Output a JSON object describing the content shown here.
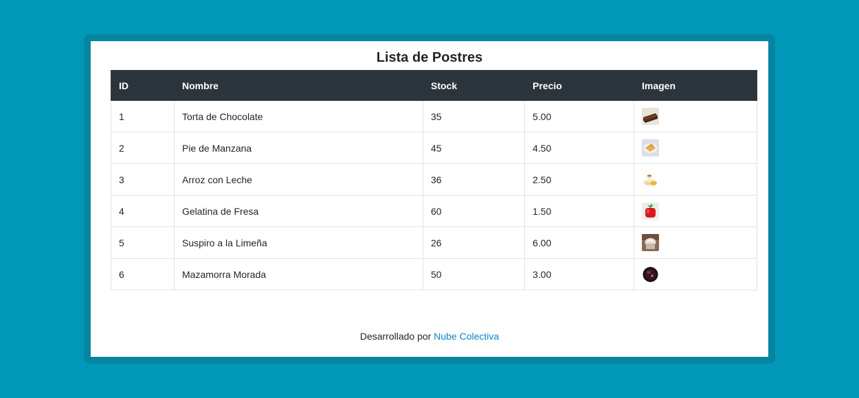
{
  "page": {
    "title": "Lista de Postres"
  },
  "table": {
    "headers": [
      "ID",
      "Nombre",
      "Stock",
      "Precio",
      "Imagen"
    ],
    "rows": [
      {
        "id": "1",
        "nombre": "Torta de Chocolate",
        "stock": "35",
        "precio": "5.00",
        "imagen_icon": "chocolate-cake-icon"
      },
      {
        "id": "2",
        "nombre": "Pie de Manzana",
        "stock": "45",
        "precio": "4.50",
        "imagen_icon": "apple-pie-icon"
      },
      {
        "id": "3",
        "nombre": "Arroz con Leche",
        "stock": "36",
        "precio": "2.50",
        "imagen_icon": "rice-pudding-icon"
      },
      {
        "id": "4",
        "nombre": "Gelatina de Fresa",
        "stock": "60",
        "precio": "1.50",
        "imagen_icon": "strawberry-jelly-icon"
      },
      {
        "id": "5",
        "nombre": "Suspiro a la Limeña",
        "stock": "26",
        "precio": "6.00",
        "imagen_icon": "suspiro-limena-icon"
      },
      {
        "id": "6",
        "nombre": "Mazamorra Morada",
        "stock": "50",
        "precio": "3.00",
        "imagen_icon": "mazamorra-morada-icon"
      }
    ]
  },
  "footer": {
    "prefix": "Desarrollado por",
    "link_label": "Nube Colectiva"
  },
  "colors": {
    "background": "#0097b9",
    "frame": "#0685a1",
    "table_header": "#2d353c",
    "link": "#0a84c9"
  }
}
